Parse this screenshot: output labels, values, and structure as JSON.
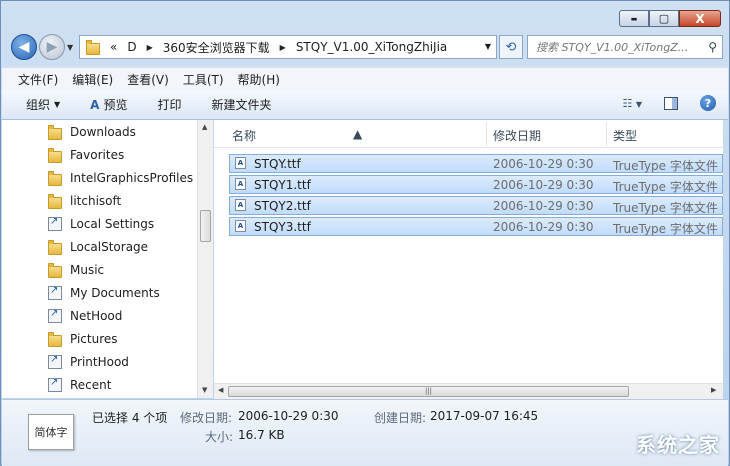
{
  "window": {
    "controls": {
      "minimize": "▬",
      "maximize": "▢",
      "close": "X"
    }
  },
  "address": {
    "overflow": "«",
    "crumbs": [
      "D",
      "360安全浏览器下载",
      "STQY_V1.00_XiTongZhiJia"
    ]
  },
  "search": {
    "placeholder": "搜索 STQY_V1.00_XiTongZ..."
  },
  "menu": [
    "文件(F)",
    "编辑(E)",
    "查看(V)",
    "工具(T)",
    "帮助(H)"
  ],
  "toolbar": {
    "organize": "组织",
    "preview": "预览",
    "print": "打印",
    "new_folder": "新建文件夹"
  },
  "nav_items": [
    {
      "label": "Downloads",
      "icon": "folder-icon"
    },
    {
      "label": "Favorites",
      "icon": "folder-icon"
    },
    {
      "label": "IntelGraphicsProfiles",
      "icon": "folder-icon"
    },
    {
      "label": "litchisoft",
      "icon": "folder-icon"
    },
    {
      "label": "Local Settings",
      "icon": "shortcut-icon"
    },
    {
      "label": "LocalStorage",
      "icon": "folder-icon"
    },
    {
      "label": "Music",
      "icon": "folder-icon"
    },
    {
      "label": "My Documents",
      "icon": "shortcut-icon"
    },
    {
      "label": "NetHood",
      "icon": "shortcut-icon"
    },
    {
      "label": "Pictures",
      "icon": "folder-icon"
    },
    {
      "label": "PrintHood",
      "icon": "shortcut-icon"
    },
    {
      "label": "Recent",
      "icon": "shortcut-icon"
    }
  ],
  "columns": {
    "name": "名称",
    "modified": "修改日期",
    "type": "类型"
  },
  "files": [
    {
      "name": "STQY.ttf",
      "modified": "2006-10-29 0:30",
      "type": "TrueType 字体文件"
    },
    {
      "name": "STQY1.ttf",
      "modified": "2006-10-29 0:30",
      "type": "TrueType 字体文件"
    },
    {
      "name": "STQY2.ttf",
      "modified": "2006-10-29 0:30",
      "type": "TrueType 字体文件"
    },
    {
      "name": "STQY3.ttf",
      "modified": "2006-10-29 0:30",
      "type": "TrueType 字体文件"
    }
  ],
  "details": {
    "preview_text": "简体字",
    "selected": "已选择 4 个项",
    "modified_label": "修改日期:",
    "modified_value": "2006-10-29 0:30",
    "created_label": "创建日期:",
    "created_value": "2017-09-07 16:45",
    "size_label": "大小:",
    "size_value": "16.7 KB"
  },
  "watermark": "系统之家"
}
